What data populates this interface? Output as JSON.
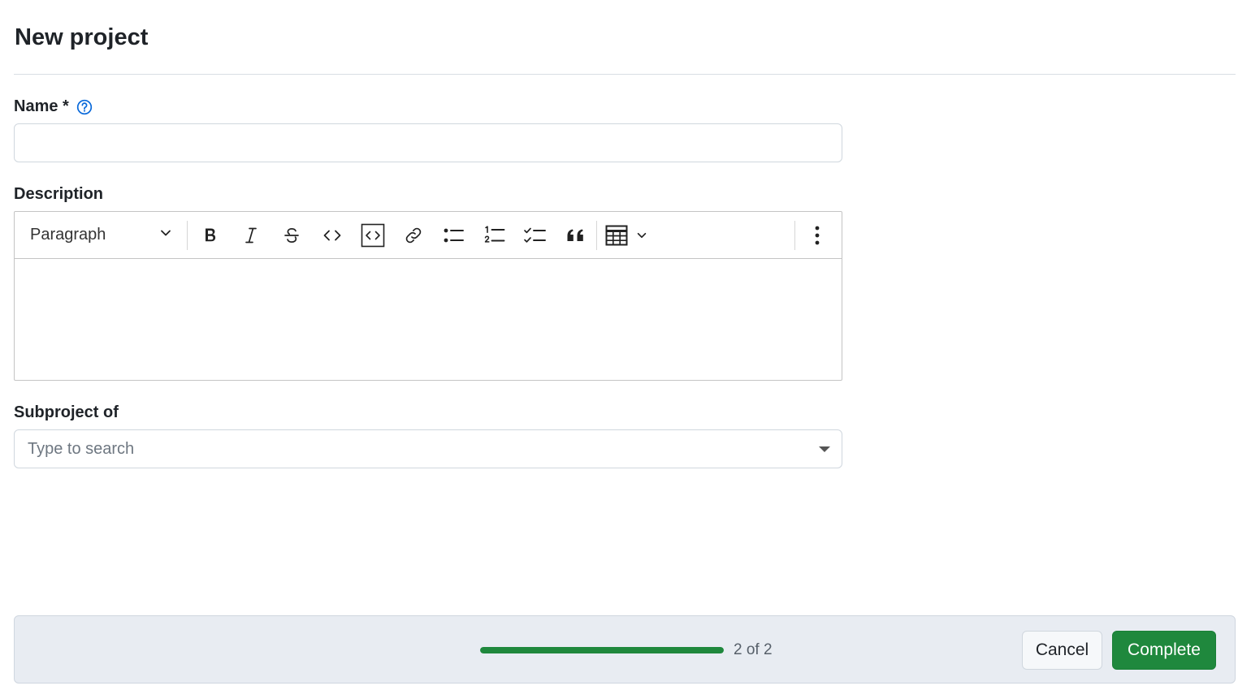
{
  "page": {
    "title": "New project"
  },
  "form": {
    "name": {
      "label": "Name *",
      "value": "",
      "placeholder": ""
    },
    "description": {
      "label": "Description",
      "heading_select": "Paragraph",
      "toolbar_icons": [
        "bold-icon",
        "italic-icon",
        "strikethrough-icon",
        "code-icon",
        "code-block-icon",
        "link-icon",
        "bulleted-list-icon",
        "numbered-list-icon",
        "todo-list-icon",
        "blockquote-icon",
        "table-icon",
        "more-vertical-icon"
      ],
      "content": ""
    },
    "subproject": {
      "label": "Subproject of",
      "placeholder": "Type to search"
    }
  },
  "footer": {
    "progress": {
      "current": 2,
      "total": 2,
      "text": "2 of 2",
      "fraction": 1.0
    },
    "cancel_label": "Cancel",
    "complete_label": "Complete"
  },
  "colors": {
    "primary": "#1f883d",
    "help_icon": "#0969da",
    "footer_bg": "#e8ecf2"
  }
}
